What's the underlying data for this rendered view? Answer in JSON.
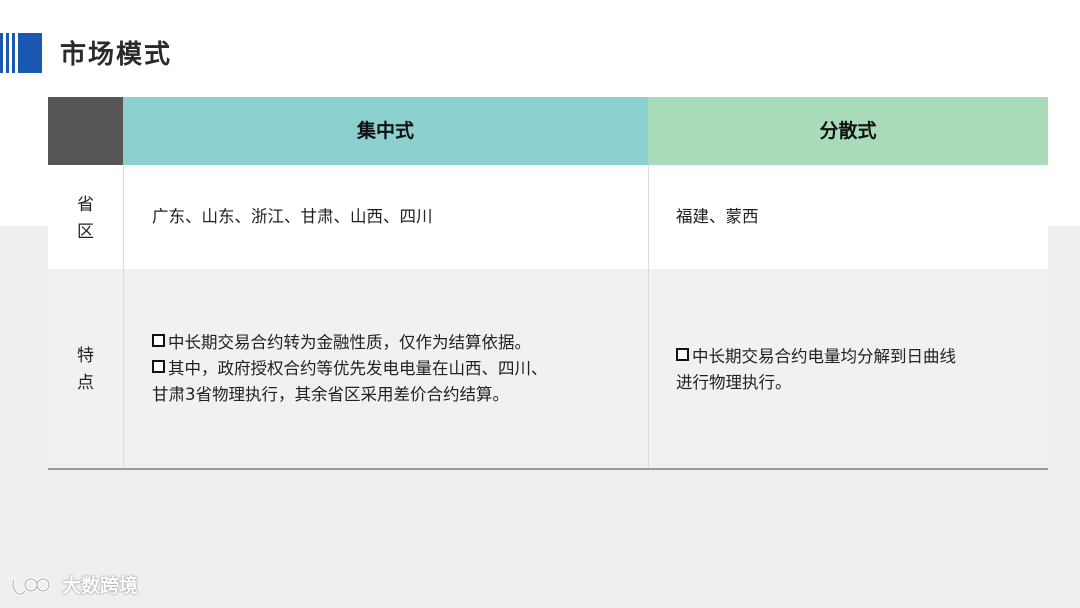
{
  "slide": {
    "title": "市场模式"
  },
  "table": {
    "columns": [
      "集中式",
      "分散式"
    ],
    "rows": [
      {
        "label": [
          "省",
          "区"
        ],
        "centralized": "广东、山东、浙江、甘肃、山西、四川",
        "distributed": "福建、蒙西"
      },
      {
        "label": [
          "特",
          "点"
        ],
        "centralized": [
          "中长期交易合约转为金融性质，仅作为结算依据。",
          "其中，政府授权合约等优先发电电量在山西、四川、",
          "甘肃3省物理执行，其余省区采用差价合约结算。"
        ],
        "distributed": [
          "中长期交易合约电量均分解到日曲线",
          "进行物理执行。"
        ]
      }
    ]
  },
  "watermark": {
    "text": "大数跨境"
  },
  "colors": {
    "accent": "#1a58b2",
    "header_corner": "#555555",
    "header_centralized": "#8ccfcf",
    "header_distributed": "#a8dbba",
    "band": "#efefef"
  }
}
